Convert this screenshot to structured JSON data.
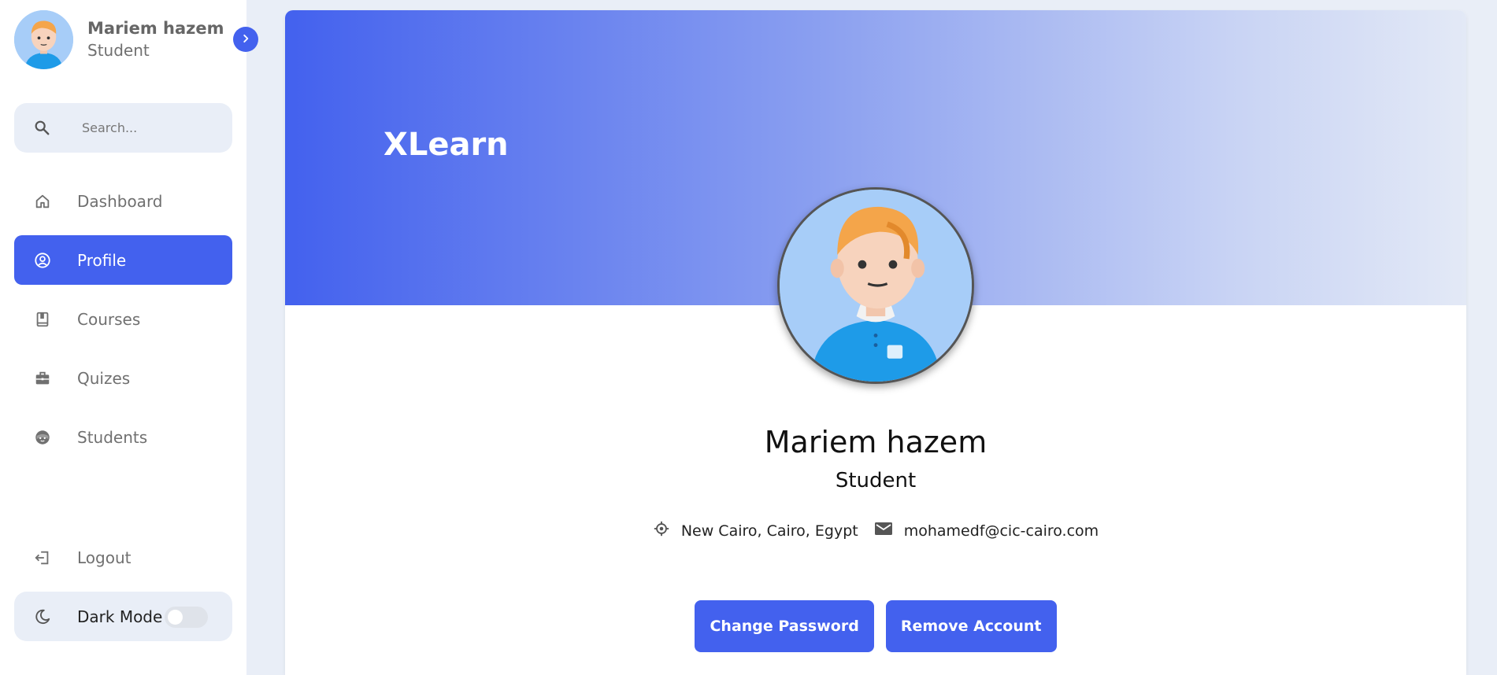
{
  "user": {
    "name": "Mariem hazem",
    "role": "Student"
  },
  "search": {
    "placeholder": "Search..."
  },
  "nav": {
    "items": [
      {
        "label": "Dashboard",
        "icon": "home-icon"
      },
      {
        "label": "Profile",
        "icon": "user-circle-icon",
        "active": true
      },
      {
        "label": "Courses",
        "icon": "book-icon"
      },
      {
        "label": "Quizes",
        "icon": "briefcase-icon"
      },
      {
        "label": "Students",
        "icon": "face-icon"
      }
    ],
    "logout": "Logout",
    "dark_mode": "Dark Mode"
  },
  "profile": {
    "brand": "XLearn",
    "name": "Mariem hazem",
    "role": "Student",
    "location": "New Cairo, Cairo, Egypt",
    "email": "mohamedf@cic-cairo.com",
    "change_password": "Change Password",
    "remove_account": "Remove Account"
  },
  "colors": {
    "accent": "#4361ee",
    "background": "#e9eef7"
  }
}
